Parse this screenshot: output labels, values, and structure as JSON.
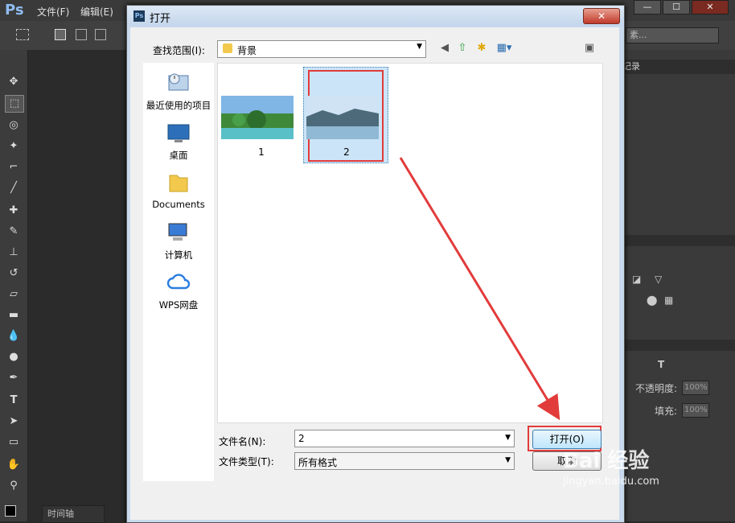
{
  "app": {
    "logo": "Ps"
  },
  "menubar": {
    "items": [
      "文件(F)",
      "编辑(E)"
    ]
  },
  "window_controls": [
    "—",
    "☐",
    "✕"
  ],
  "optbar": {
    "search_hint": "素..."
  },
  "right_panel": {
    "history_tab": "记录",
    "opacity_label": "不透明度:",
    "opacity_value": "100%",
    "fill_label": "填充:",
    "fill_value": "100%"
  },
  "timeline_tab": "时间轴",
  "dialog": {
    "title": "打开",
    "close_label": "✕",
    "lookin_label": "查找范围(I):",
    "lookin_value": "背景",
    "places": [
      "最近使用的项目",
      "桌面",
      "Documents",
      "计算机",
      "WPS网盘"
    ],
    "files": [
      "1",
      "2"
    ],
    "filename_label": "文件名(N):",
    "filename_value": "2",
    "filetype_label": "文件类型(T):",
    "filetype_value": "所有格式",
    "open_button": "打开(O)",
    "cancel_button": "取消"
  },
  "watermark": {
    "text": "Bai 经验",
    "url": "jingyan.baidu.com"
  },
  "colors": {
    "annotation_red": "#e23b3b",
    "selection_blue": "#cce4f7"
  }
}
